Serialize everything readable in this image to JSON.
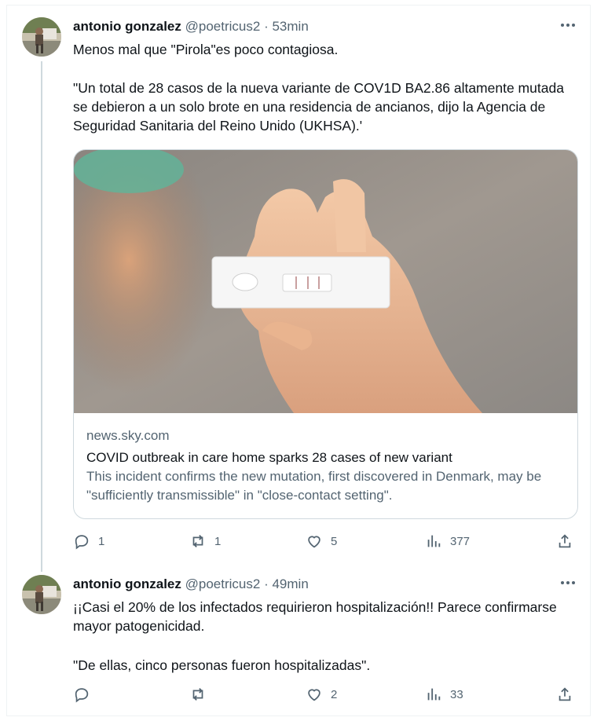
{
  "tweets": [
    {
      "author": "antonio gonzalez",
      "handle": "@poetricus2",
      "separator": "·",
      "time": "53min",
      "text1": "Menos mal que \"Pirola\"es poco contagiosa.",
      "text2": "\"Un total de 28 casos de la nueva variante de COV1D BA2.86 altamente mutada se debieron a un solo brote en una residencia de ancianos, dijo la Agencia de Seguridad Sanitaria del Reino Unido (UKHSA).'",
      "card": {
        "domain": "news.sky.com",
        "title": "COVID outbreak in care home sparks 28 cases of new variant",
        "description": "This incident confirms the new mutation, first discovered in Denmark, may be \"sufficiently transmissible\" in \"close-contact setting\"."
      },
      "replies": "1",
      "retweets": "1",
      "likes": "5",
      "views": "377"
    },
    {
      "author": "antonio gonzalez",
      "handle": "@poetricus2",
      "separator": "·",
      "time": "49min",
      "text1": "¡¡Casi el 20% de los infectados requirieron hospitalización!! Parece confirmarse mayor patogenicidad.",
      "text2": "\"De ellas, cinco personas fueron hospitalizadas\".",
      "replies": "",
      "retweets": "",
      "likes": "2",
      "views": "33"
    }
  ],
  "icons": {
    "more": "more-icon",
    "reply": "reply-icon",
    "retweet": "retweet-icon",
    "like": "like-icon",
    "views": "views-icon",
    "share": "share-icon"
  },
  "colors": {
    "text": "#0f1419",
    "secondary": "#536471",
    "border": "#cfd9de"
  }
}
